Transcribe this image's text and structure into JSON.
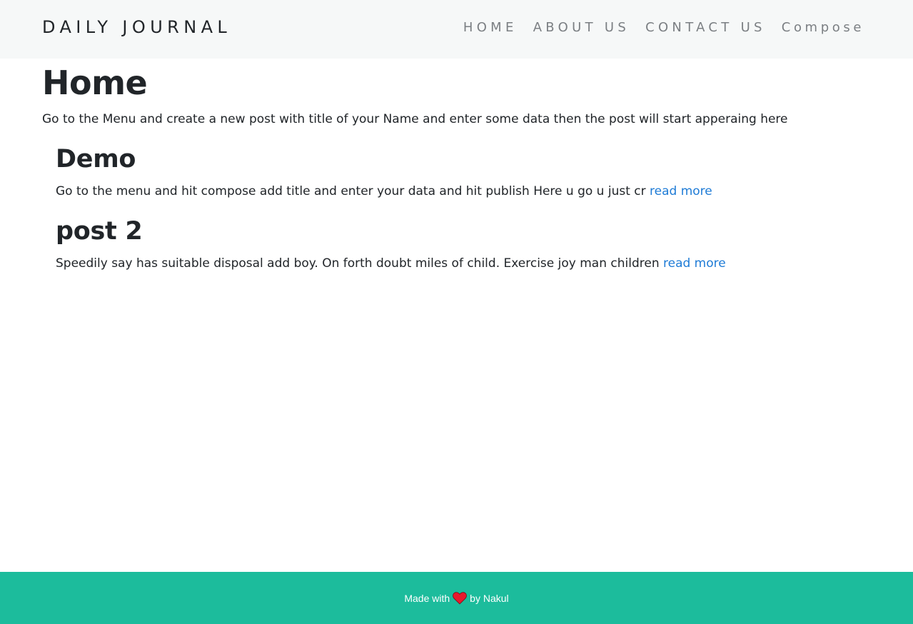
{
  "navbar": {
    "brand": "DAILY JOURNAL",
    "links": [
      {
        "label": "HOME"
      },
      {
        "label": "ABOUT US"
      },
      {
        "label": "CONTACT US"
      },
      {
        "label": "Compose"
      }
    ]
  },
  "main": {
    "title": "Home",
    "intro": "Go to the Menu and create a new post with title of your Name and enter some data then the post will start apperaing here",
    "posts": [
      {
        "title": "Demo",
        "excerpt": "Go to the menu and hit compose add title and enter your data and hit publish Here u go u just cr",
        "link_label": "read more"
      },
      {
        "title": "post 2",
        "excerpt": "Speedily say has suitable disposal add boy. On forth doubt miles of child. Exercise joy man children",
        "link_label": "read more"
      }
    ]
  },
  "footer": {
    "prefix": "Made with",
    "icon": "heart-icon",
    "suffix": "by Nakul",
    "heart_color": "#e8192c"
  },
  "colors": {
    "navbar_bg": "#f6f8f8",
    "footer_bg": "#1cbc9c",
    "link": "#1e7bd6",
    "nav_text": "#7b7f83"
  }
}
